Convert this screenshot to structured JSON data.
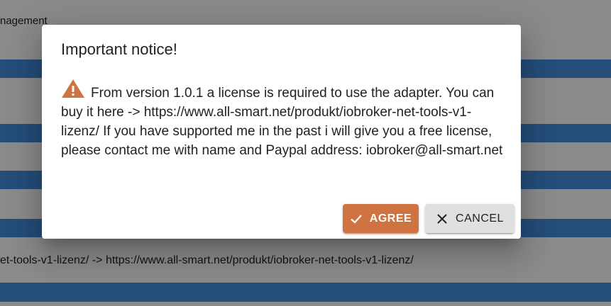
{
  "background": {
    "top_text": "nagement",
    "bottom_text": "et-tools-v1-lizenz/ -> https://www.all-smart.net/produkt/iobroker-net-tools-v1-lizenz/"
  },
  "dialog": {
    "title": "Important notice!",
    "icon": "warning-triangle-icon",
    "message": "From version 1.0.1 a license is required to use the adapter. You can buy it here -> https://www.all-smart.net/produkt/iobroker-net-tools-v1-lizenz/ If you have supported me in the past i will give you a free license, please contact me with name and Paypal address: iobroker@all-smart.net",
    "agree_label": "AGREE",
    "cancel_label": "CANCEL"
  },
  "colors": {
    "accent": "#cf7441",
    "stripe": "#3e86d0",
    "cancel_bg": "#e0e0e0"
  }
}
